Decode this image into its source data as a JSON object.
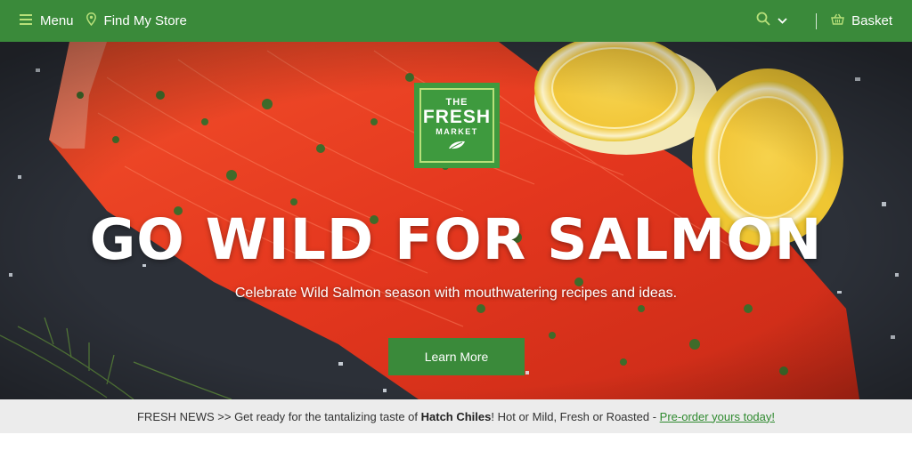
{
  "nav": {
    "menu_label": "Menu",
    "find_store_label": "Find My Store",
    "basket_label": "Basket",
    "icons": {
      "menu": "hamburger-icon",
      "store": "location-pin-icon",
      "search": "search-icon",
      "chevron": "chevron-down-icon",
      "basket": "basket-icon"
    }
  },
  "hero": {
    "logo": {
      "line1": "THE",
      "line2": "FRESH",
      "line3": "MARKET"
    },
    "title": "GO WILD FOR SALMON",
    "subtitle": "Celebrate Wild Salmon season with mouthwatering recipes and ideas.",
    "cta_label": "Learn More"
  },
  "news": {
    "prefix": "FRESH NEWS >> Get ready for the tantalizing taste of ",
    "highlight": "Hatch Chiles",
    "middle": "! Hot or Mild, Fresh or Roasted - ",
    "link": "Pre-order yours today!"
  },
  "colors": {
    "brand_green": "#3a8a3a",
    "logo_green": "#3e9a3e",
    "icon_lime": "#b8e07a",
    "news_bg": "#ececec",
    "link_green": "#2f8a2f"
  }
}
